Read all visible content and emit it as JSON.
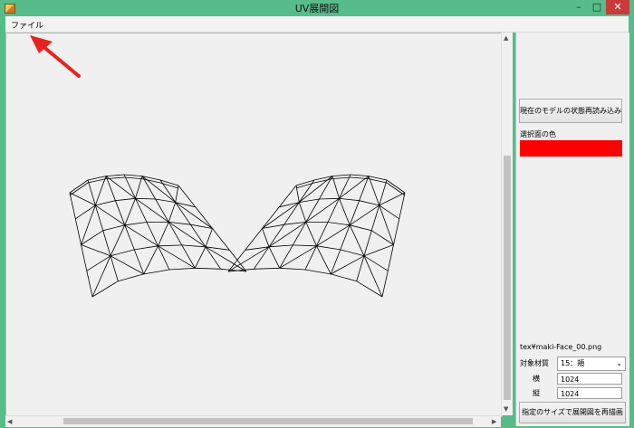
{
  "window": {
    "title": "UV展開図",
    "min": "–",
    "max": "□",
    "close": "✕"
  },
  "menu": {
    "file": "ファイル"
  },
  "panel": {
    "reload_button": "現在のモデルの状態再読み込み",
    "selected_face_color_label": "選択面の色",
    "selected_face_color": "#ff0000",
    "texture_file": "tex¥maki-Face_00.png",
    "material_label": "対象材質",
    "material_value": "15：頬",
    "width_label": "横",
    "width_value": "1024",
    "height_label": "縦",
    "height_value": "1024",
    "redraw_button": "指定のサイズで展開図を再描画"
  },
  "annotation": {
    "arrow_color": "#e8231f"
  },
  "icons": [
    "app-icon",
    "minimize-icon",
    "maximize-icon",
    "close-icon",
    "dropdown-arrow-icon",
    "scroll-up-icon",
    "scroll-down-icon",
    "scroll-left-icon",
    "scroll-right-icon"
  ]
}
